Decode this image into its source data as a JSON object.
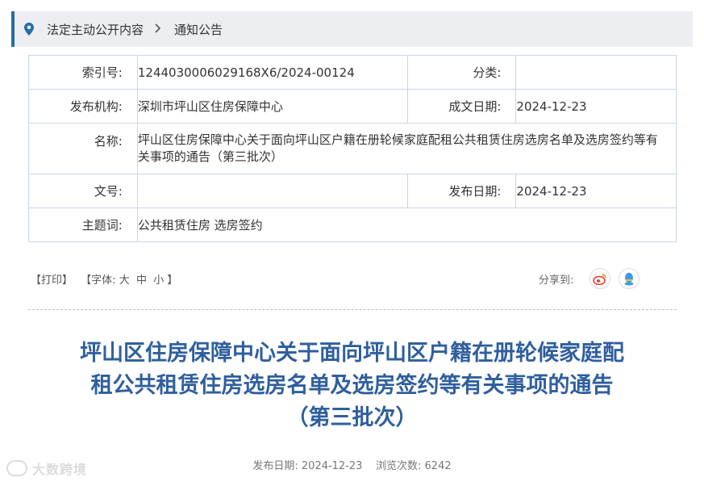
{
  "breadcrumb": {
    "section": "法定主动公开内容",
    "current": "通知公告"
  },
  "info": {
    "index_label": "索引号:",
    "index_value": "1244030006029168X6/2024-00124",
    "category_label": "分类:",
    "category_value": "",
    "publisher_label": "发布机构:",
    "publisher_value": "深圳市坪山区住房保障中心",
    "created_label": "成文日期:",
    "created_value": "2024-12-23",
    "name_label": "名称:",
    "name_value": "坪山区住房保障中心关于面向坪山区户籍在册轮候家庭配租公共租赁住房选房名单及选房签约等有关事项的通告（第三批次）",
    "docno_label": "文号:",
    "docno_value": "",
    "published_label": "发布日期:",
    "published_value": "2024-12-23",
    "topic_label": "主题词:",
    "topic_value": "公共租赁住房 选房签约"
  },
  "tools": {
    "print": "【打印】",
    "font_prefix": "【字体:",
    "font_large": "大",
    "font_medium": "中",
    "font_small": "小",
    "font_suffix": "】",
    "share_label": "分享到:"
  },
  "article": {
    "title_line1": "坪山区住房保障中心关于面向坪山区户籍在册轮候家庭配",
    "title_line2": "租公共租赁住房选房名单及选房签约等有关事项的通告",
    "title_line3": "（第三批次）",
    "date_label": "发布日期:",
    "date_value": "2024-12-23",
    "views_label": "浏览次数:",
    "views_value": "6242"
  },
  "watermark": "大数跨境",
  "colors": {
    "accent": "#2b6aa8",
    "title": "#2f5f9e",
    "weibo": "#e6412e",
    "qq": "#3d9be9"
  }
}
